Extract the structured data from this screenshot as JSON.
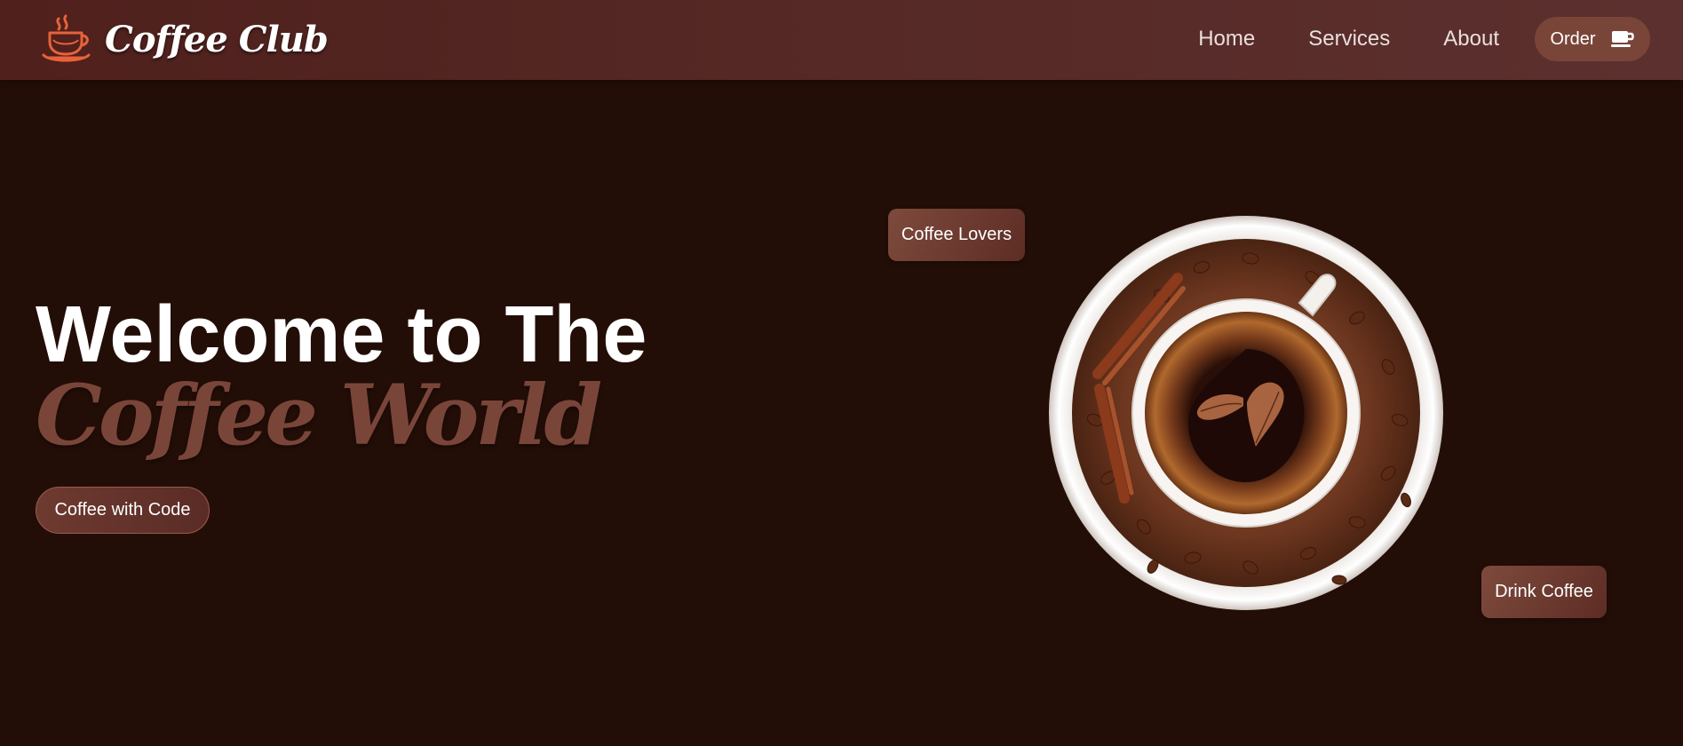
{
  "header": {
    "brand_name": "Coffee Club",
    "brand_icon": "coffee-cup-logo-icon",
    "nav": [
      "Home",
      "Services",
      "About"
    ],
    "order_label": "Order",
    "order_icon": "coffee-mug-icon"
  },
  "hero": {
    "title": "Welcome to The",
    "subtitle": "Coffee World",
    "cta_label": "Coffee with Code"
  },
  "tags": {
    "top": "Coffee Lovers",
    "bottom": "Drink Coffee"
  },
  "colors": {
    "background": "#230e07",
    "navbar": "#552825",
    "accent": "#7a4539",
    "logo_orange": "#e8623a"
  }
}
